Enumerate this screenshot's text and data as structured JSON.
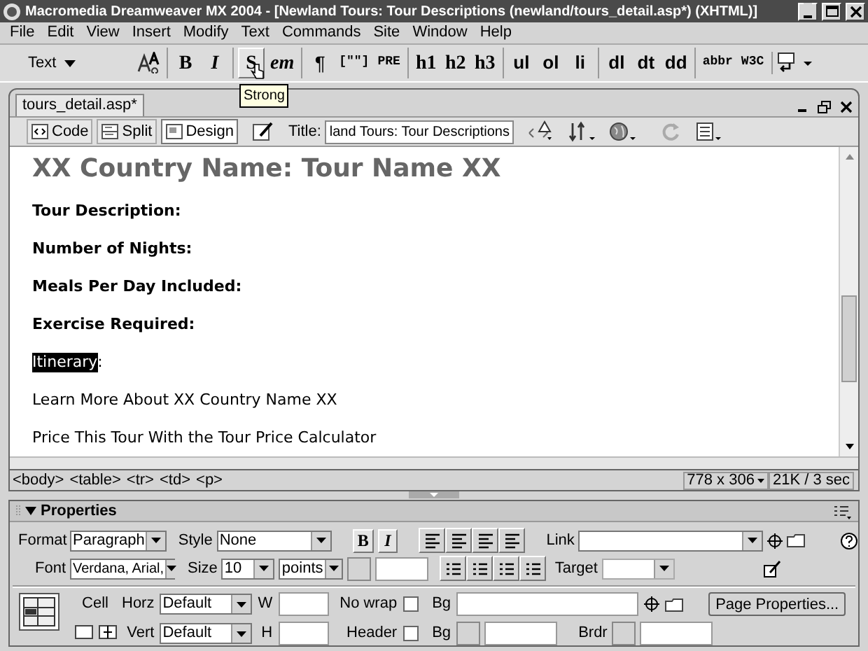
{
  "window": {
    "title": "Macromedia Dreamweaver MX 2004 - [Newland Tours: Tour Descriptions (newland/tours_detail.asp*) (XHTML)]"
  },
  "menu": [
    "File",
    "Edit",
    "View",
    "Insert",
    "Modify",
    "Text",
    "Commands",
    "Site",
    "Window",
    "Help"
  ],
  "insert_bar": {
    "category": "Text",
    "button_groups": [
      [
        {
          "label": "B",
          "kind": "bold",
          "hovered": false
        },
        {
          "label": "I",
          "kind": "italic",
          "hovered": false
        }
      ],
      [
        {
          "label": "S",
          "kind": "bold",
          "hovered": true
        },
        {
          "label": "em",
          "kind": "italic",
          "hovered": false
        }
      ],
      [
        {
          "label": "¶",
          "kind": "plain",
          "hovered": false
        },
        {
          "label": "[\"\"]",
          "kind": "mono",
          "hovered": false
        },
        {
          "label": "PRE",
          "kind": "mono",
          "hovered": false
        }
      ],
      [
        {
          "label": "h1",
          "kind": "serif",
          "hovered": false
        },
        {
          "label": "h2",
          "kind": "serif",
          "hovered": false
        },
        {
          "label": "h3",
          "kind": "serif",
          "hovered": false
        }
      ],
      [
        {
          "label": "ul",
          "kind": "sans",
          "hovered": false
        },
        {
          "label": "ol",
          "kind": "sans",
          "hovered": false
        },
        {
          "label": "li",
          "kind": "sans",
          "hovered": false
        }
      ],
      [
        {
          "label": "dl",
          "kind": "sans",
          "hovered": false
        },
        {
          "label": "dt",
          "kind": "sans",
          "hovered": false
        },
        {
          "label": "dd",
          "kind": "sans",
          "hovered": false
        }
      ],
      [
        {
          "label": "abbr",
          "kind": "mono",
          "hovered": false
        },
        {
          "label": "W3C",
          "kind": "mono",
          "hovered": false
        }
      ]
    ],
    "tooltip": "Strong"
  },
  "document": {
    "tab": "tours_detail.asp*",
    "views": [
      {
        "label": "Code",
        "selected": false
      },
      {
        "label": "Split",
        "selected": false
      },
      {
        "label": "Design",
        "selected": true
      }
    ],
    "title_label": "Title:",
    "title_value": "land Tours: Tour Descriptions",
    "heading": "XX Country Name: Tour Name XX",
    "paragraphs": [
      {
        "text": "Tour Description:",
        "bold": true,
        "selected": false
      },
      {
        "text": "Number of Nights:",
        "bold": true,
        "selected": false
      },
      {
        "text": "Meals Per Day Included:",
        "bold": true,
        "selected": false
      },
      {
        "text": "Exercise Required:",
        "bold": true,
        "selected": false
      },
      {
        "text": "Itinerary",
        "after": ":",
        "bold": false,
        "selected": true
      },
      {
        "text": "Learn More About XX Country Name XX",
        "bold": false,
        "selected": false
      },
      {
        "text": "Price This Tour With the Tour Price Calculator",
        "bold": false,
        "selected": false
      }
    ]
  },
  "status_bar": {
    "tags": [
      "<body>",
      "<table>",
      "<tr>",
      "<td>",
      "<p>"
    ],
    "window_size": "778 x 306",
    "download": "21K / 3 sec"
  },
  "properties": {
    "title": "Properties",
    "bold_button": "B",
    "italic_button": "I",
    "format_label": "Format",
    "format": "Paragraph",
    "style_label": "Style",
    "style": "None",
    "link_label": "Link",
    "font_label": "Font",
    "font": "Verdana, Arial,",
    "size_label": "Size",
    "size": "10",
    "units": "points",
    "target_label": "Target",
    "cell_label": "Cell",
    "horz_label": "Horz",
    "horz": "Default",
    "w_label": "W",
    "no_wrap_label": "No wrap",
    "no_wrap": false,
    "bg_label": "Bg",
    "vert_label": "Vert",
    "vert": "Default",
    "h_label": "H",
    "header_label": "Header",
    "header": false,
    "bg2_label": "Bg",
    "brdr_label": "Brdr",
    "page_properties": "Page Properties..."
  }
}
